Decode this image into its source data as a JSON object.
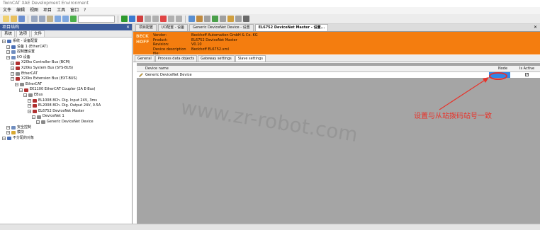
{
  "window": {
    "title": "TwinCAT XAE Development Environment"
  },
  "menu": [
    "文件",
    "编辑",
    "视图",
    "项目",
    "工具",
    "窗口",
    "?"
  ],
  "left_pane": {
    "title": "项目结构",
    "tabs": [
      "系统",
      "选项",
      "文件"
    ],
    "tree": [
      {
        "text": "系统 - 设备配置",
        "level": 0,
        "color": "#4a6fb5"
      },
      {
        "text": "设备 1 (EtherCAT)",
        "level": 1,
        "color": "#4a6fb5"
      },
      {
        "text": "控制器设置",
        "level": 1,
        "color": "#6f8dbf"
      },
      {
        "text": "I/O 设备",
        "level": 1,
        "color": "#6f8dbf"
      },
      {
        "text": "X20ks Controller Bus (BCM)",
        "level": 2,
        "color": "#b03030"
      },
      {
        "text": "X20ks System Bus (SYS-BUS)",
        "level": 2,
        "color": "#b03030"
      },
      {
        "text": "EtherCAT",
        "level": 2,
        "color": "#8a8a8a"
      },
      {
        "text": "X20ks Extension Bus (EXT-BUS)",
        "level": 2,
        "color": "#b03030"
      },
      {
        "text": "EtherCAT",
        "level": 3,
        "color": "#8a8a8a"
      },
      {
        "text": "EK1100 EtherCAT Coupler (2A E-Bus)",
        "level": 4,
        "color": "#b03030"
      },
      {
        "text": "EBus",
        "level": 5,
        "color": "#8a8a8a"
      },
      {
        "text": "EL1008 8Ch. Dig. Input 24V, 3ms",
        "level": 6,
        "color": "#b03030"
      },
      {
        "text": "EL2008 8Ch. Dig. Output 24V, 0.5A",
        "level": 6,
        "color": "#b03030"
      },
      {
        "text": "EL6752 DeviceNet Master",
        "level": 6,
        "color": "#b03030"
      },
      {
        "text": "DeviceNet 1",
        "level": 7,
        "color": "#8a8a8a"
      },
      {
        "text": "Generic DeviceNet Device",
        "level": 8,
        "color": "#8a8a8a"
      },
      {
        "text": "安全控制",
        "level": 1,
        "color": "#6f8dbf"
      },
      {
        "text": "模块",
        "level": 1,
        "color": "#d9a830"
      },
      {
        "text": "不分配的对象",
        "level": 0,
        "color": "#4a6fb5"
      }
    ]
  },
  "doc_tabs": [
    {
      "label": "项目配置",
      "active": false
    },
    {
      "label": "I/O配置 - 设备",
      "active": false
    },
    {
      "label": "Generic DeviceNet Device - 设置",
      "active": false
    },
    {
      "label": "EL6752 DeviceNet Master - 设置...",
      "active": true
    }
  ],
  "banner": {
    "logo": "BECK HOFF",
    "rows": [
      {
        "key": "Vendor:",
        "value": "Beckhoff Automation GmbH & Co. KG"
      },
      {
        "key": "Product:",
        "value": "EL6752 DeviceNet Master"
      },
      {
        "key": "Revision:",
        "value": "V0.10"
      },
      {
        "key": "Device description file:",
        "value": "Beckhoff EL6752.xml"
      }
    ]
  },
  "sub_tabs": [
    {
      "label": "General",
      "active": false
    },
    {
      "label": "Process data objects",
      "active": false
    },
    {
      "label": "Gateway settings",
      "active": false
    },
    {
      "label": "Slave settings",
      "active": true
    }
  ],
  "table": {
    "headers": {
      "name": "Device name",
      "node": "Node",
      "active": "Is Active"
    },
    "rows": [
      {
        "name": "Generic DeviceNet Device",
        "node": "",
        "active": true
      }
    ]
  },
  "annotation": {
    "text": "设置与从站拨码站号一致",
    "color": "#e8332a"
  },
  "watermark": "www.zr-robot.com"
}
